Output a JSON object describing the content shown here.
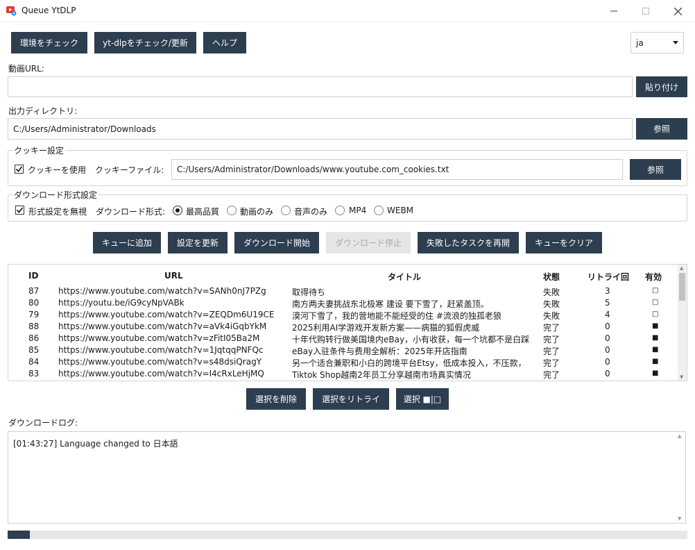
{
  "window": {
    "title": "Queue YtDLP"
  },
  "toolbar": {
    "check_env": "環境をチェック",
    "check_ytdlp": "yt-dlpをチェック/更新",
    "help": "ヘルプ"
  },
  "language": {
    "value": "ja"
  },
  "url": {
    "label": "動画URL:",
    "value": "",
    "paste": "貼り付け"
  },
  "output": {
    "label": "出力ディレクトリ:",
    "value": "C:/Users/Administrator/Downloads",
    "browse": "参照"
  },
  "cookie": {
    "group_title": "クッキー設定",
    "use_label": "クッキーを使用",
    "use_checked": true,
    "file_label": "クッキーファイル:",
    "file_value": "C:/Users/Administrator/Downloads/www.youtube.com_cookies.txt",
    "browse": "参照"
  },
  "format": {
    "group_title": "ダウンロード形式設定",
    "ignore_label": "形式設定を無視",
    "ignore_checked": true,
    "format_label": "ダウンロード形式:",
    "options": [
      "最高品質",
      "動画のみ",
      "音声のみ",
      "MP4",
      "WEBM"
    ],
    "selected": "最高品質"
  },
  "actions": {
    "add_queue": "キューに追加",
    "update_settings": "設定を更新",
    "start_download": "ダウンロード開始",
    "stop_download": "ダウンロード停止",
    "resume_failed": "失敗したタスクを再開",
    "clear_queue": "キューをクリア"
  },
  "table": {
    "headers": {
      "id": "ID",
      "url": "URL",
      "title": "タイトル",
      "status": "状態",
      "retry": "リトライ回",
      "enabled": "有効"
    },
    "rows": [
      {
        "id": "87",
        "url": "https://www.youtube.com/watch?v=SANh0nJ7PZg",
        "title": "取得待ち",
        "status": "失敗",
        "retry": "3",
        "enabled": "□"
      },
      {
        "id": "80",
        "url": "https://youtu.be/iG9cyNpVABk",
        "title": "南方两夫妻挑战东北极寒 建设 要下雪了，赶紧盖顶。",
        "status": "失敗",
        "retry": "5",
        "enabled": "□"
      },
      {
        "id": "79",
        "url": "https://www.youtube.com/watch?v=ZEQDm6U19CE",
        "title": "漠河下雪了，我的营地能不能经受的住 #流浪的独孤老狼",
        "status": "失敗",
        "retry": "4",
        "enabled": "□"
      },
      {
        "id": "88",
        "url": "https://www.youtube.com/watch?v=aVk4iGqbYkM",
        "title": "2025利用AI学游戏开发新方案——病猫的狐假虎威",
        "status": "完了",
        "retry": "0",
        "enabled": "■"
      },
      {
        "id": "86",
        "url": "https://www.youtube.com/watch?v=zFitI05Ba2M",
        "title": "十年代购转行做美国境内eBay，小有收获，每一个坑都不是白踩",
        "status": "完了",
        "retry": "0",
        "enabled": "■"
      },
      {
        "id": "85",
        "url": "https://www.youtube.com/watch?v=1JqtqqPNFQc",
        "title": "eBay入驻条件与费用全解析：2025年开店指南",
        "status": "完了",
        "retry": "0",
        "enabled": "■"
      },
      {
        "id": "84",
        "url": "https://www.youtube.com/watch?v=s48dsiQragY",
        "title": "另一个适合兼职和小白的跨境平台Etsy，低成本投入，不压款，",
        "status": "完了",
        "retry": "0",
        "enabled": "■"
      },
      {
        "id": "83",
        "url": "https://www.youtube.com/watch?v=I4cRxLeHjMQ",
        "title": "Tiktok Shop越南2年员工分享越南市场真实情况",
        "status": "完了",
        "retry": "0",
        "enabled": "■"
      }
    ]
  },
  "selection": {
    "delete": "選択を削除",
    "retry": "選択をリトライ",
    "toggle": "選択 ■|□"
  },
  "log": {
    "label": "ダウンロードログ:",
    "text": "[01:43:27] Language changed to 日本語"
  },
  "progress": {
    "fraction": 0.033
  },
  "colors": {
    "accent": "#2c3e50",
    "disabled": "#e6e6e6"
  }
}
